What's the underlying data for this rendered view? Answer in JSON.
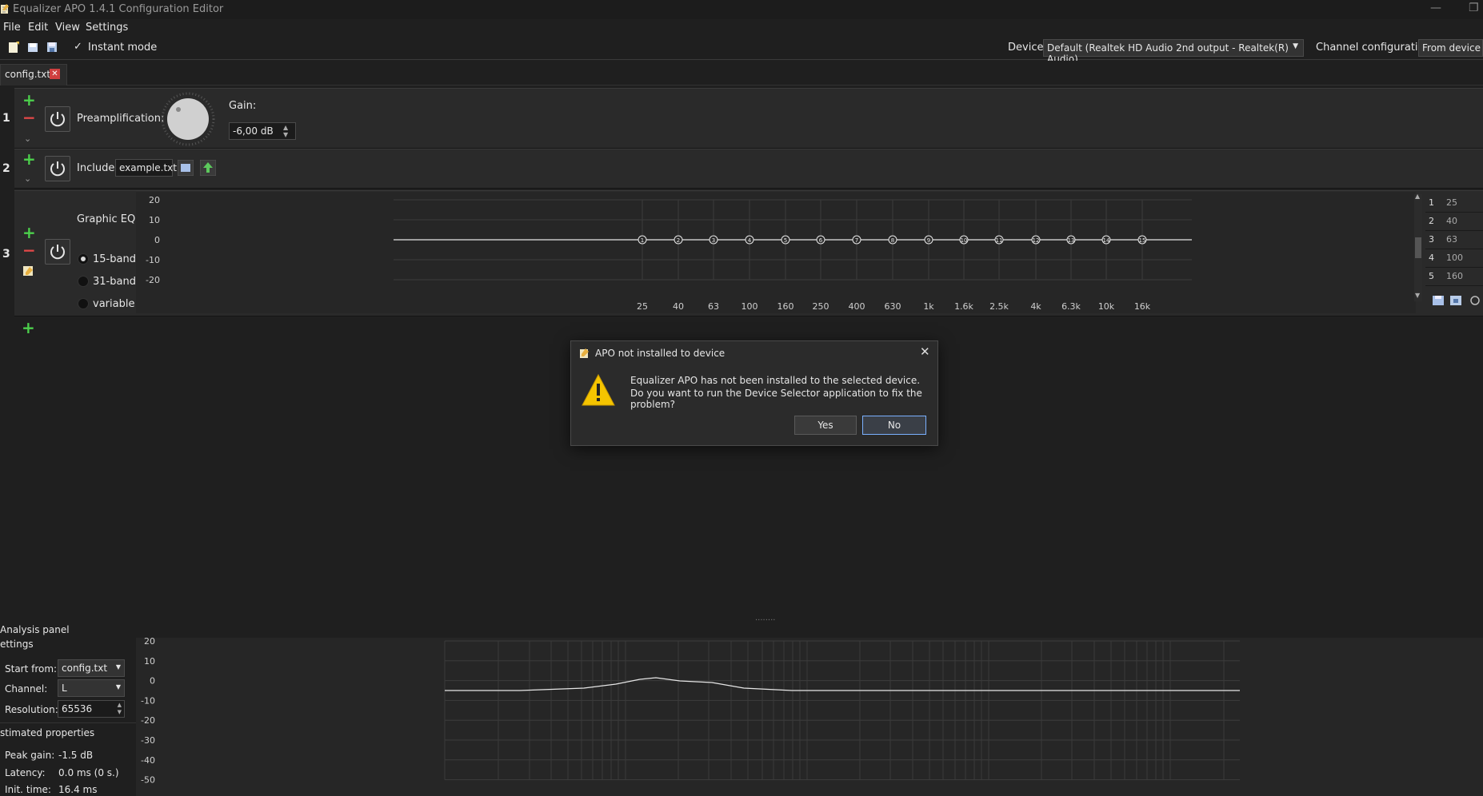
{
  "window": {
    "title": "Equalizer APO 1.4.1 Configuration Editor"
  },
  "menu": [
    "File",
    "Edit",
    "View",
    "Settings"
  ],
  "toolbar": {
    "instant_mode": "Instant mode",
    "device_label": "Device:",
    "device_value": "Default (Realtek HD Audio 2nd output - Realtek(R) Audio)",
    "channel_label": "Channel configuration:",
    "channel_value": "From device (S"
  },
  "tabs": [
    {
      "label": "config.txt"
    }
  ],
  "rows": {
    "r1": {
      "num": "1",
      "label": "Preamplification:",
      "gain_label": "Gain:",
      "gain_value": "-6,00 dB"
    },
    "r2": {
      "num": "2",
      "label": "Include:",
      "file": "example.txt"
    },
    "r3": {
      "num": "3",
      "label": "Graphic EQ:",
      "options": [
        "15-band",
        "31-band",
        "variable"
      ]
    }
  },
  "eq_graph": {
    "y_ticks": [
      "20",
      "10",
      "0",
      "-10",
      "-20"
    ],
    "x_ticks": [
      "25",
      "40",
      "63",
      "100",
      "160",
      "250",
      "400",
      "630",
      "1k",
      "1.6k",
      "2.5k",
      "4k",
      "6.3k",
      "10k",
      "16k"
    ]
  },
  "side_table": [
    {
      "idx": "1",
      "freq": "25"
    },
    {
      "idx": "2",
      "freq": "40"
    },
    {
      "idx": "3",
      "freq": "63"
    },
    {
      "idx": "4",
      "freq": "100"
    },
    {
      "idx": "5",
      "freq": "160"
    }
  ],
  "dialog": {
    "title": "APO not installed to device",
    "line1": "Equalizer APO has not been installed to the selected device.",
    "line2": "Do you want to run the Device Selector application to fix the problem?",
    "yes": "Yes",
    "no": "No"
  },
  "analysis": {
    "header1": "Analysis panel",
    "header2": "ettings",
    "start_from_label": "Start from:",
    "start_from_value": "config.txt",
    "channel_label": "Channel:",
    "channel_value": "L",
    "resolution_label": "Resolution:",
    "resolution_value": "65536",
    "estimated_header": "stimated properties",
    "peak_gain_label": "Peak gain:",
    "peak_gain_value": "-1.5 dB",
    "latency_label": "Latency:",
    "latency_value": "0.0 ms (0 s.)",
    "init_time_label": "Init. time:",
    "init_time_value": "16.4 ms",
    "y_ticks": [
      "20",
      "10",
      "0",
      "-10",
      "-20",
      "-30",
      "-40",
      "-50"
    ]
  },
  "colors": {
    "add": "#4cd04c",
    "remove": "#e04848",
    "warning": "#f5c400",
    "accent": "#7ab0ff"
  }
}
